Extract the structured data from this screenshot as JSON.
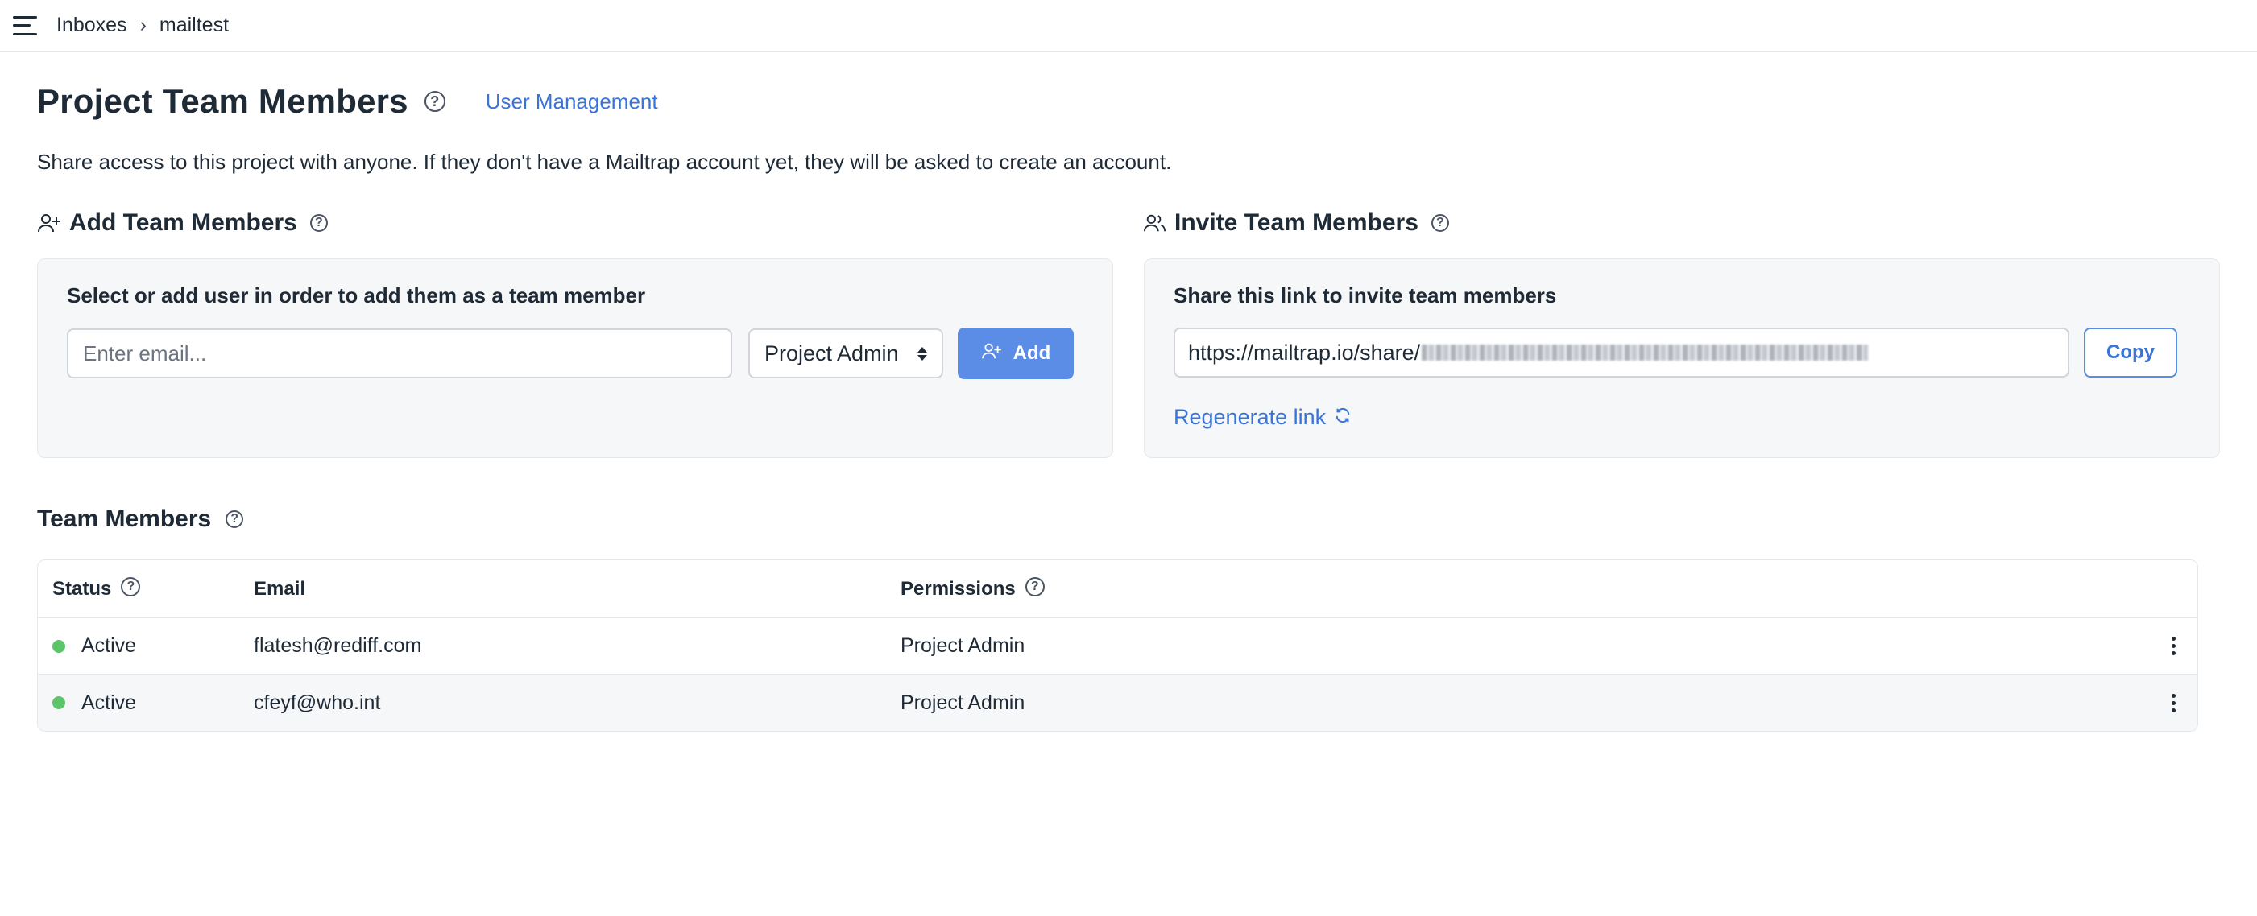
{
  "breadcrumb": {
    "root": "Inboxes",
    "separator": "›",
    "current": "mailtest"
  },
  "header": {
    "title": "Project Team Members",
    "user_management_link": "User Management",
    "description": "Share access to this project with anyone. If they don't have a Mailtrap account yet, they will be asked to create an account."
  },
  "add_section": {
    "title": "Add Team Members",
    "card_title": "Select or add user in order to add them as a team member",
    "email_placeholder": "Enter email...",
    "role_selected": "Project Admin",
    "add_label": "Add"
  },
  "invite_section": {
    "title": "Invite Team Members",
    "card_title": "Share this link to invite team members",
    "link_prefix": "https://mailtrap.io/share/",
    "copy_label": "Copy",
    "regenerate_label": "Regenerate link"
  },
  "team": {
    "title": "Team Members",
    "columns": {
      "status": "Status",
      "email": "Email",
      "permissions": "Permissions"
    },
    "rows": [
      {
        "status": "Active",
        "email": "flatesh@rediff.com",
        "permission": "Project Admin"
      },
      {
        "status": "Active",
        "email": "cfeyf@who.int",
        "permission": "Project Admin"
      }
    ]
  },
  "colors": {
    "accent": "#3b74d8",
    "button": "#5b8de6",
    "status_active": "#5cc56a",
    "text": "#1f2a37"
  },
  "icons": {
    "menu": "menu-icon",
    "help": "help-circle-icon",
    "add_user": "user-plus-icon",
    "users": "users-icon",
    "refresh": "refresh-icon",
    "more": "more-vertical-icon"
  }
}
